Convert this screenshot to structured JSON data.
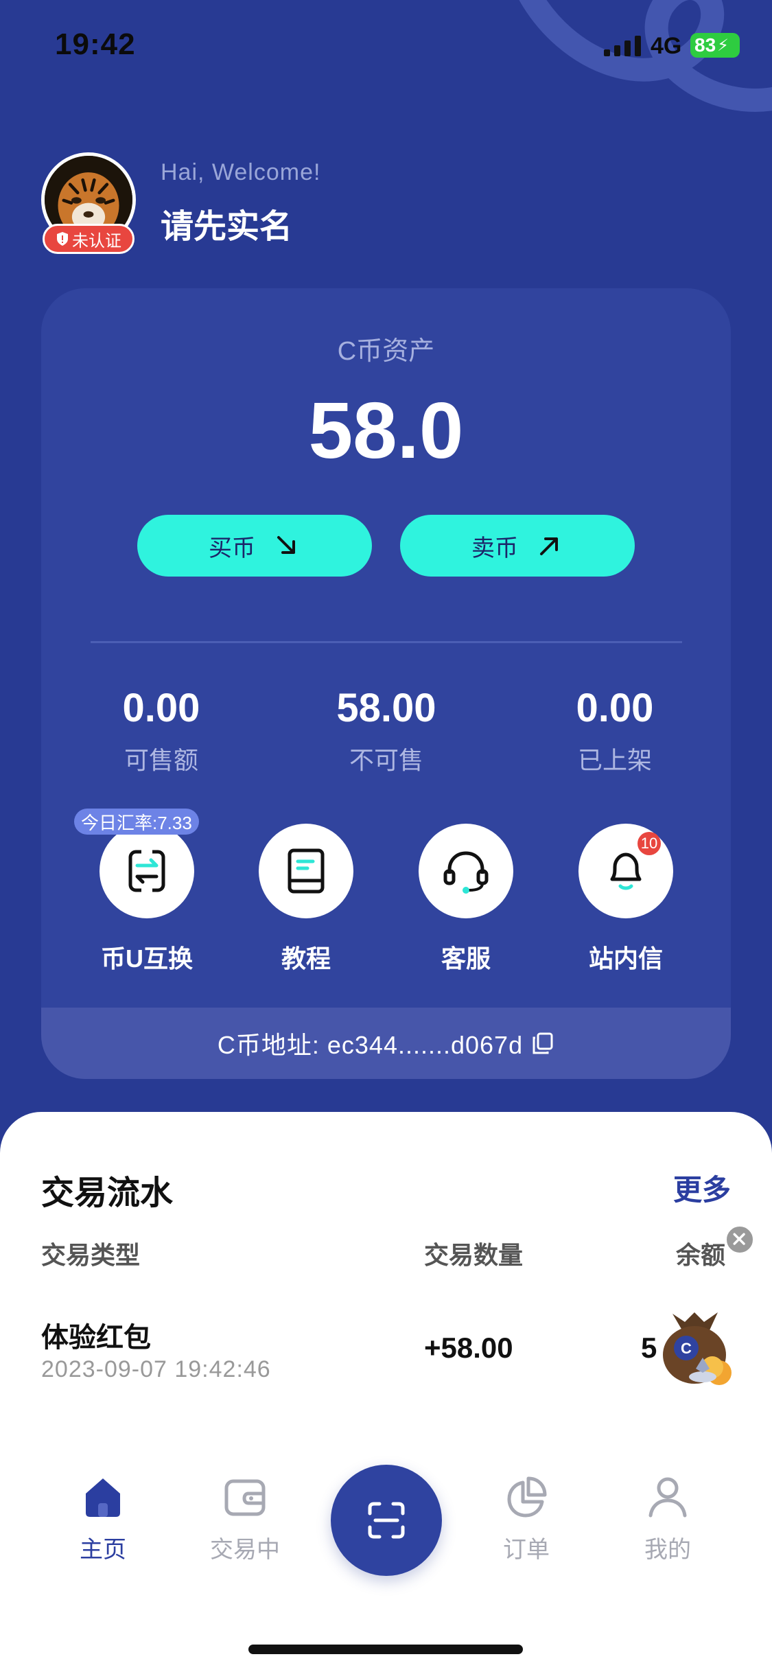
{
  "status_bar": {
    "time": "19:42",
    "network": "4G",
    "battery": "83"
  },
  "header": {
    "welcome": "Hai, Welcome!",
    "user_name": "请先实名",
    "verify_badge": "未认证"
  },
  "asset_card": {
    "title": "C币资产",
    "amount": "58.0",
    "buy_label": "买币",
    "sell_label": "卖币",
    "stats": [
      {
        "value": "0.00",
        "label": "可售额"
      },
      {
        "value": "58.00",
        "label": "不可售"
      },
      {
        "value": "0.00",
        "label": "已上架"
      }
    ],
    "exchange_rate": "今日汇率:7.33",
    "actions": [
      {
        "label": "币U互换",
        "icon": "exchange-icon"
      },
      {
        "label": "教程",
        "icon": "book-icon"
      },
      {
        "label": "客服",
        "icon": "headset-icon"
      },
      {
        "label": "站内信",
        "icon": "bell-icon",
        "badge": "10"
      }
    ],
    "address": "C币地址: ec344.......d067d"
  },
  "transactions": {
    "title": "交易流水",
    "more": "更多",
    "columns": [
      "交易类型",
      "交易数量",
      "余额"
    ],
    "rows": [
      {
        "type": "体验红包",
        "date": "2023-09-07 19:42:46",
        "amount": "+58.00",
        "balance": "5"
      }
    ]
  },
  "tab_bar": {
    "items": [
      {
        "label": "主页",
        "icon": "home-icon",
        "active": true
      },
      {
        "label": "交易中",
        "icon": "wallet-icon",
        "active": false
      },
      {
        "label": "订单",
        "icon": "pie-chart-icon",
        "active": false
      },
      {
        "label": "我的",
        "icon": "user-icon",
        "active": false
      }
    ],
    "center_icon": "scan-icon"
  },
  "colors": {
    "primary": "#283a93",
    "card": "#31449e",
    "accent": "#2ff3de",
    "badge_red": "#e8463f",
    "active_tab": "#2b3ea0"
  }
}
